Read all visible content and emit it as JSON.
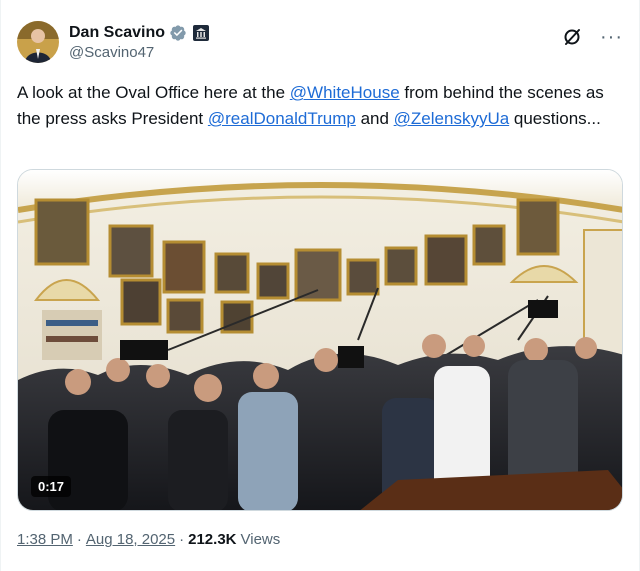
{
  "author": {
    "display_name": "Dan Scavino",
    "handle": "@Scavino47",
    "verified_icon": "verified-badge-icon",
    "affiliation_icon": "government-affiliation-icon"
  },
  "actions": {
    "grok_icon": "grok-icon",
    "more_label": "···"
  },
  "tweet": {
    "text_1": "A look at the Oval Office here at the ",
    "mention_1": "@WhiteHouse",
    "text_2": " from behind the scenes as the press asks President ",
    "mention_2": "@realDonaldTrump",
    "text_3": " and ",
    "mention_3": "@ZelenskyyUa",
    "text_4": " questions..."
  },
  "media": {
    "type": "video",
    "duration": "0:17"
  },
  "meta": {
    "time": "1:38 PM",
    "separator": "·",
    "date": "Aug 18, 2025",
    "views_count": "212.3K",
    "views_label": "Views"
  },
  "colors": {
    "link": "#1d6bd6",
    "secondary_text": "#536471",
    "verified_blue": "#1d9bf0"
  }
}
